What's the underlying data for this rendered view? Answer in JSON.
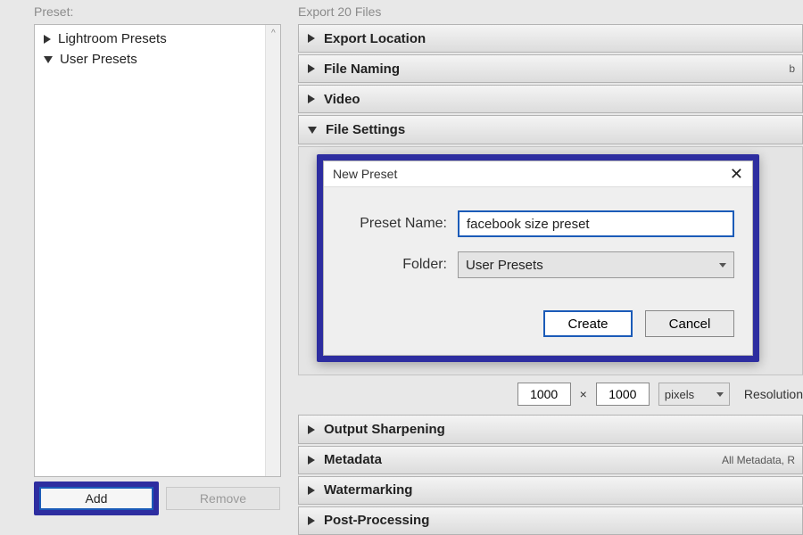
{
  "left": {
    "label": "Preset:",
    "items": [
      {
        "label": "Lightroom Presets",
        "expanded": false
      },
      {
        "label": "User Presets",
        "expanded": true
      }
    ],
    "add_button": "Add",
    "remove_button": "Remove"
  },
  "right": {
    "label": "Export 20 Files",
    "sections": {
      "export_location": "Export Location",
      "file_naming": "File Naming",
      "file_naming_extra": "b",
      "video": "Video",
      "file_settings": "File Settings",
      "output_sharpening": "Output Sharpening",
      "metadata": "Metadata",
      "metadata_extra": "All Metadata, R",
      "watermarking": "Watermarking",
      "post_processing": "Post-Processing"
    },
    "dims": {
      "w": "1000",
      "h": "1000",
      "unit": "pixels",
      "times": "×",
      "resolution_label": "Resolution"
    }
  },
  "modal": {
    "title": "New Preset",
    "name_label": "Preset Name:",
    "name_value": "facebook size preset",
    "folder_label": "Folder:",
    "folder_value": "User Presets",
    "create": "Create",
    "cancel": "Cancel"
  }
}
